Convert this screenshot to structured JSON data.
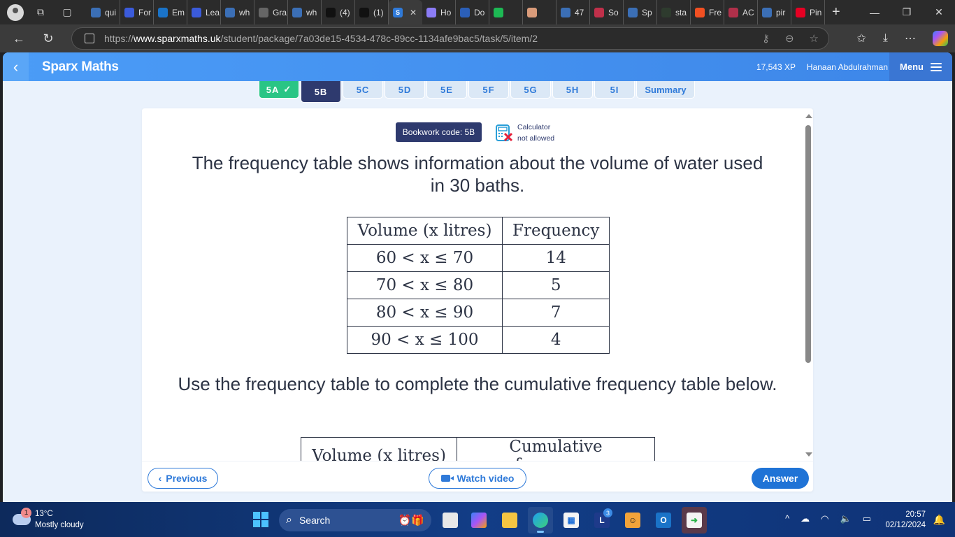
{
  "browser": {
    "tabs": [
      {
        "label": "qui",
        "icon": "search-icon",
        "color": "#3b6fb6"
      },
      {
        "label": "For",
        "icon": "forms-icon",
        "color": "#3b5bdb"
      },
      {
        "label": "Em",
        "icon": "outlook-icon",
        "color": "#1a73c8"
      },
      {
        "label": "Lea",
        "icon": "forms-icon",
        "color": "#3b5bdb"
      },
      {
        "label": "wh",
        "icon": "search-icon",
        "color": "#3b6fb6"
      },
      {
        "label": "Gra",
        "icon": "document-icon",
        "color": "#666666"
      },
      {
        "label": "wh",
        "icon": "search-icon",
        "color": "#3b6fb6"
      },
      {
        "label": "(4)",
        "icon": "tiktok-icon",
        "color": "#111111"
      },
      {
        "label": "(1)",
        "icon": "tiktok-icon",
        "color": "#111111"
      },
      {
        "label": "S",
        "icon": "sparx-icon",
        "color": "#2f7ad9",
        "active": true
      },
      {
        "label": "Ho",
        "icon": "hex-icon",
        "color": "#8b7cf6"
      },
      {
        "label": "Do",
        "icon": "word-icon",
        "color": "#2b5fb8"
      },
      {
        "label": "",
        "icon": "spotify-icon",
        "color": "#1db954"
      },
      {
        "label": "",
        "icon": "hand-icon",
        "color": "#d99b7a"
      },
      {
        "label": "47",
        "icon": "search-icon",
        "color": "#3b6fb6"
      },
      {
        "label": "So",
        "icon": "x-icon",
        "color": "#c0304a"
      },
      {
        "label": "Sp",
        "icon": "search-icon",
        "color": "#3b6fb6"
      },
      {
        "label": "sta",
        "icon": "stats-icon",
        "color": "#2e3b2e"
      },
      {
        "label": "Fre",
        "icon": "microsoft-icon",
        "color": "#f25022"
      },
      {
        "label": "AC",
        "icon": "slash-icon",
        "color": "#b0304a"
      },
      {
        "label": "pir",
        "icon": "search-icon",
        "color": "#3b6fb6"
      },
      {
        "label": "Pin",
        "icon": "pinterest-icon",
        "color": "#e60023"
      }
    ],
    "url_prefix": "https://",
    "url_domain": "www.sparxmaths.uk",
    "url_path": "/student/package/7a03de15-4534-478c-89cc-1134afe9bac5/task/5/item/2"
  },
  "app": {
    "title": "Sparx Maths",
    "xp": "17,543 XP",
    "user": "Hanaan Abdulrahman",
    "menu_label": "Menu"
  },
  "task_tabs": [
    {
      "label": "5A",
      "state": "done",
      "check": "✓"
    },
    {
      "label": "5B",
      "state": "current"
    },
    {
      "label": "5C",
      "state": "todo"
    },
    {
      "label": "5D",
      "state": "todo"
    },
    {
      "label": "5E",
      "state": "todo"
    },
    {
      "label": "5F",
      "state": "todo"
    },
    {
      "label": "5G",
      "state": "todo"
    },
    {
      "label": "5H",
      "state": "todo"
    },
    {
      "label": "5I",
      "state": "todo"
    },
    {
      "label": "Summary",
      "state": "todo"
    }
  ],
  "question": {
    "bookwork_code": "Bookwork code: 5B",
    "calculator_line1": "Calculator",
    "calculator_line2": "not allowed",
    "intro_text": "The frequency table shows information about the volume of water used in 30 baths.",
    "table1": {
      "headers": [
        "Volume (x litres)",
        "Frequency"
      ],
      "rows": [
        {
          "range": "60 < x ≤ 70",
          "frequency": "14"
        },
        {
          "range": "70 < x ≤ 80",
          "frequency": "5"
        },
        {
          "range": "80 < x ≤ 90",
          "frequency": "7"
        },
        {
          "range": "90 < x ≤ 100",
          "frequency": "4"
        }
      ]
    },
    "instruction_text": "Use the frequency table to complete the cumulative frequency table below.",
    "table2": {
      "headers": [
        "Volume (x litres)",
        "Cumulative frequency"
      ]
    }
  },
  "footer": {
    "previous_label": "Previous",
    "video_label": "Watch video",
    "answer_label": "Answer"
  },
  "taskbar": {
    "weather_badge": "1",
    "temperature": "13°C",
    "weather_desc": "Mostly cloudy",
    "search_label": "Search",
    "notification_count": "3",
    "time": "20:57",
    "date": "02/12/2024"
  }
}
